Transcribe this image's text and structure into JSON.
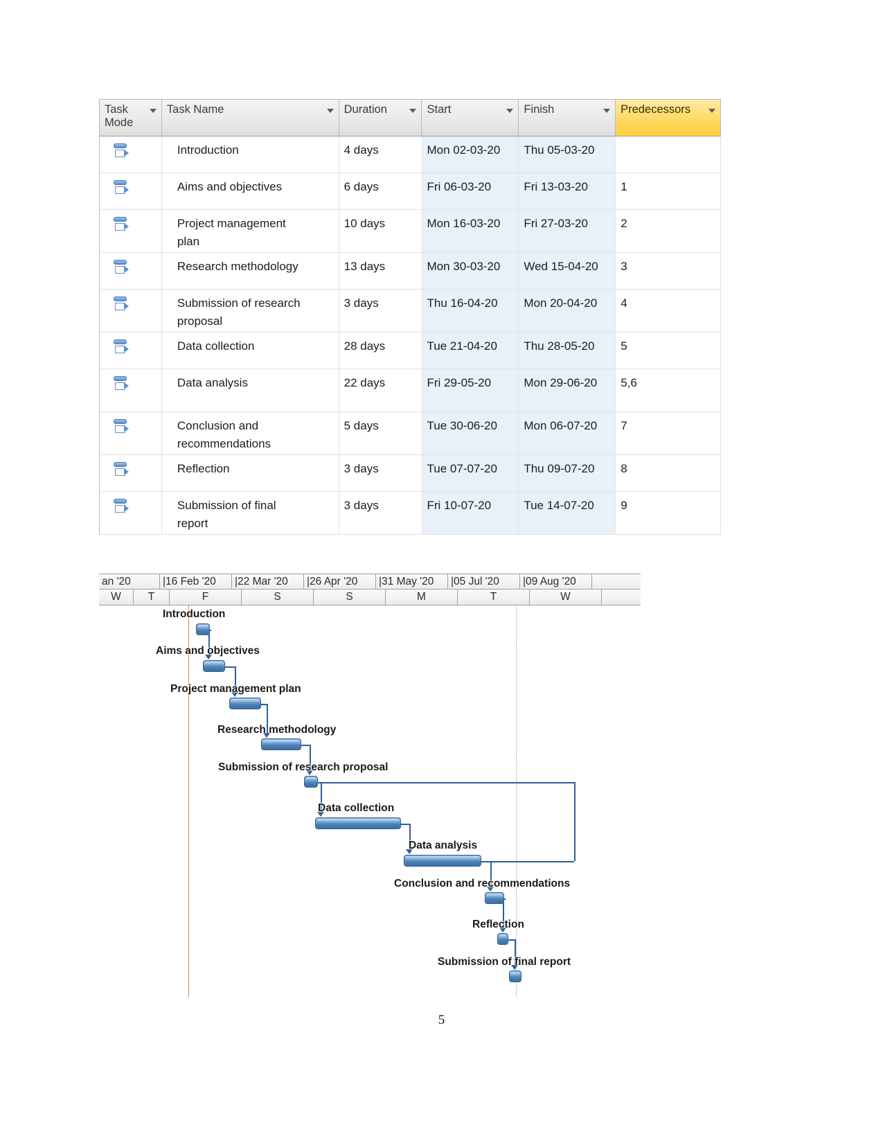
{
  "table": {
    "columns": [
      {
        "key": "mode",
        "label": "Task\nMode",
        "has_filter": true,
        "highlight": false
      },
      {
        "key": "name",
        "label": "Task Name",
        "has_filter": true,
        "highlight": false
      },
      {
        "key": "duration",
        "label": "Duration",
        "has_filter": true,
        "highlight": false
      },
      {
        "key": "start",
        "label": "Start",
        "has_filter": true,
        "highlight": false
      },
      {
        "key": "finish",
        "label": "Finish",
        "has_filter": true,
        "highlight": false
      },
      {
        "key": "predecessors",
        "label": "Predecessors",
        "has_filter": true,
        "highlight": true
      }
    ],
    "rows": [
      {
        "mode_icon": "auto-schedule-icon",
        "name": "Introduction",
        "duration": "4 days",
        "start": "Mon 02-03-20",
        "finish": "Thu 05-03-20",
        "predecessors": ""
      },
      {
        "mode_icon": "auto-schedule-icon",
        "name": "Aims and objectives",
        "duration": "6 days",
        "start": "Fri 06-03-20",
        "finish": "Fri 13-03-20",
        "predecessors": "1"
      },
      {
        "mode_icon": "auto-schedule-icon",
        "name": "Project management\nplan",
        "duration": "10 days",
        "start": "Mon 16-03-20",
        "finish": "Fri 27-03-20",
        "predecessors": "2"
      },
      {
        "mode_icon": "auto-schedule-icon",
        "name": "Research methodology",
        "duration": "13 days",
        "start": "Mon 30-03-20",
        "finish": "Wed 15-04-20",
        "predecessors": "3"
      },
      {
        "mode_icon": "auto-schedule-icon",
        "name": "Submission of research\nproposal",
        "duration": "3 days",
        "start": "Thu 16-04-20",
        "finish": "Mon 20-04-20",
        "predecessors": "4"
      },
      {
        "mode_icon": "auto-schedule-icon",
        "name": "Data collection",
        "duration": "28 days",
        "start": "Tue 21-04-20",
        "finish": "Thu 28-05-20",
        "predecessors": "5"
      },
      {
        "mode_icon": "auto-schedule-icon",
        "name": "Data analysis",
        "duration": "22 days",
        "start": "Fri 29-05-20",
        "finish": "Mon 29-06-20",
        "predecessors": "5,6"
      },
      {
        "mode_icon": "auto-schedule-icon",
        "name": "Conclusion and\nrecommendations",
        "duration": "5 days",
        "start": "Tue 30-06-20",
        "finish": "Mon 06-07-20",
        "predecessors": "7"
      },
      {
        "mode_icon": "auto-schedule-icon",
        "name": "Reflection",
        "duration": "3 days",
        "start": "Tue 07-07-20",
        "finish": "Thu 09-07-20",
        "predecessors": "8"
      },
      {
        "mode_icon": "auto-schedule-icon",
        "name": "Submission of final\nreport",
        "duration": "3 days",
        "start": "Fri 10-07-20",
        "finish": "Tue 14-07-20",
        "predecessors": "9"
      }
    ]
  },
  "gantt": {
    "timeline_months": [
      "an '20",
      "16 Feb '20",
      "22 Mar '20",
      "26 Apr '20",
      "31 May '20",
      "05 Jul '20",
      "09 Aug '20"
    ],
    "timeline_days": [
      "W",
      "T",
      "F",
      "S",
      "S",
      "M",
      "T",
      "W"
    ],
    "today_line_color": "#e08a33",
    "status_line_color": "#9a9a9a",
    "bar_color": "#4a7fb5",
    "link_color": "#2f5f96",
    "bars": [
      {
        "label": "Introduction",
        "duration_days": 4
      },
      {
        "label": "Aims and objectives",
        "duration_days": 6
      },
      {
        "label": "Project management plan",
        "duration_days": 10
      },
      {
        "label": "Research methodology",
        "duration_days": 13
      },
      {
        "label": "Submission of research proposal",
        "duration_days": 3
      },
      {
        "label": "Data collection",
        "duration_days": 28
      },
      {
        "label": "Data analysis",
        "duration_days": 22
      },
      {
        "label": "Conclusion and recommendations",
        "duration_days": 5
      },
      {
        "label": "Reflection",
        "duration_days": 3
      },
      {
        "label": "Submission of final report",
        "duration_days": 3
      }
    ]
  },
  "footer": {
    "page_number": "5"
  }
}
